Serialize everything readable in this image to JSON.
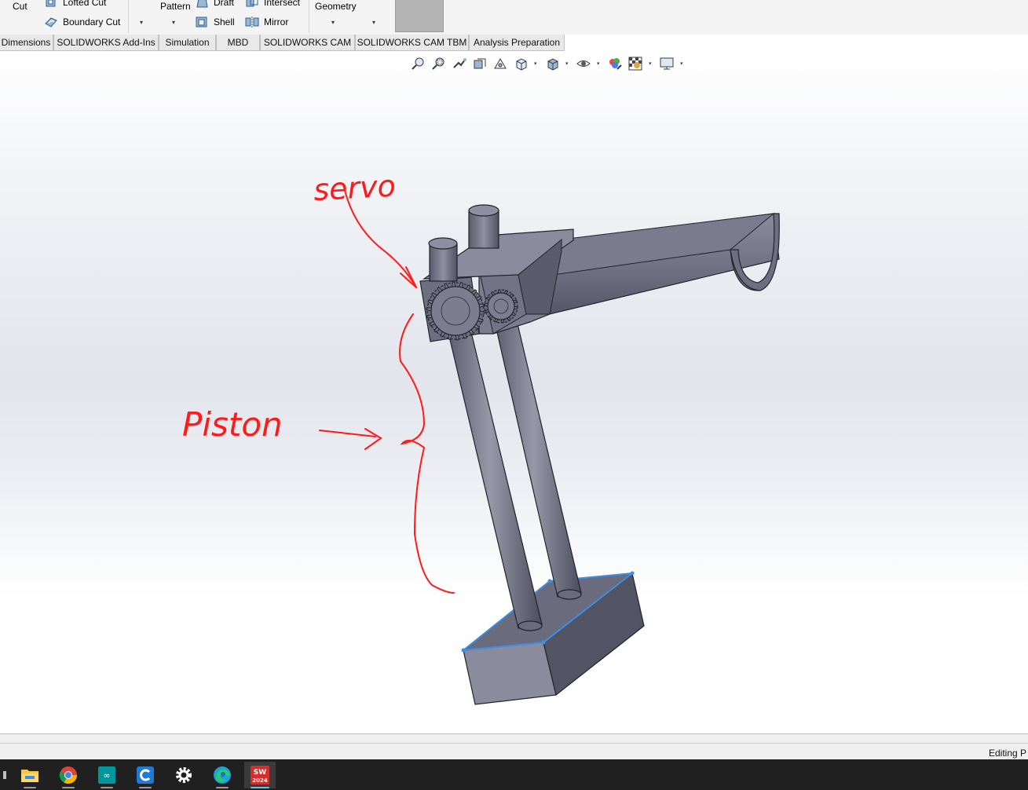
{
  "ribbon": {
    "cut_label": "Cut",
    "lofted_cut_label": "Lofted Cut",
    "boundary_cut_label": "Boundary Cut",
    "pattern_label": "Pattern",
    "draft_label": "Draft",
    "shell_label": "Shell",
    "intersect_label": "Intersect",
    "mirror_label": "Mirror",
    "geometry_label": "Geometry",
    "caret": "▾"
  },
  "tabs": [
    {
      "label": "Dimensions"
    },
    {
      "label": "SOLIDWORKS Add-Ins"
    },
    {
      "label": "Simulation"
    },
    {
      "label": "MBD"
    },
    {
      "label": "SOLIDWORKS CAM"
    },
    {
      "label": "SOLIDWORKS CAM TBM"
    },
    {
      "label": "Analysis Preparation"
    }
  ],
  "view_toolbar": {
    "icons": [
      "zoom-to-fit-icon",
      "zoom-to-area-icon",
      "previous-view-icon",
      "section-view-icon",
      "dynamic-annotation-icon",
      "view-orientation-icon",
      "display-style-icon",
      "hide-show-items-icon",
      "edit-appearance-icon",
      "apply-scene-icon",
      "view-settings-icon"
    ]
  },
  "annotations": {
    "servo_text": "servo",
    "piston_text": "Piston",
    "ink_color": "#ff1a1a"
  },
  "model": {
    "face_light": "#8a8b9c",
    "face_mid": "#6d6e80",
    "face_dark": "#4f5060",
    "edge_color": "#22232c",
    "selected_edge_color": "#3b8fe6"
  },
  "status_bar": {
    "text": "Editing P"
  },
  "taskbar": {
    "apps": [
      {
        "name": "file-explorer"
      },
      {
        "name": "google-chrome"
      },
      {
        "name": "arduino-ide"
      },
      {
        "name": "ccleaner"
      },
      {
        "name": "settings"
      },
      {
        "name": "microsoft-edge"
      },
      {
        "name": "solidworks-2024",
        "badge": "2024"
      }
    ]
  }
}
